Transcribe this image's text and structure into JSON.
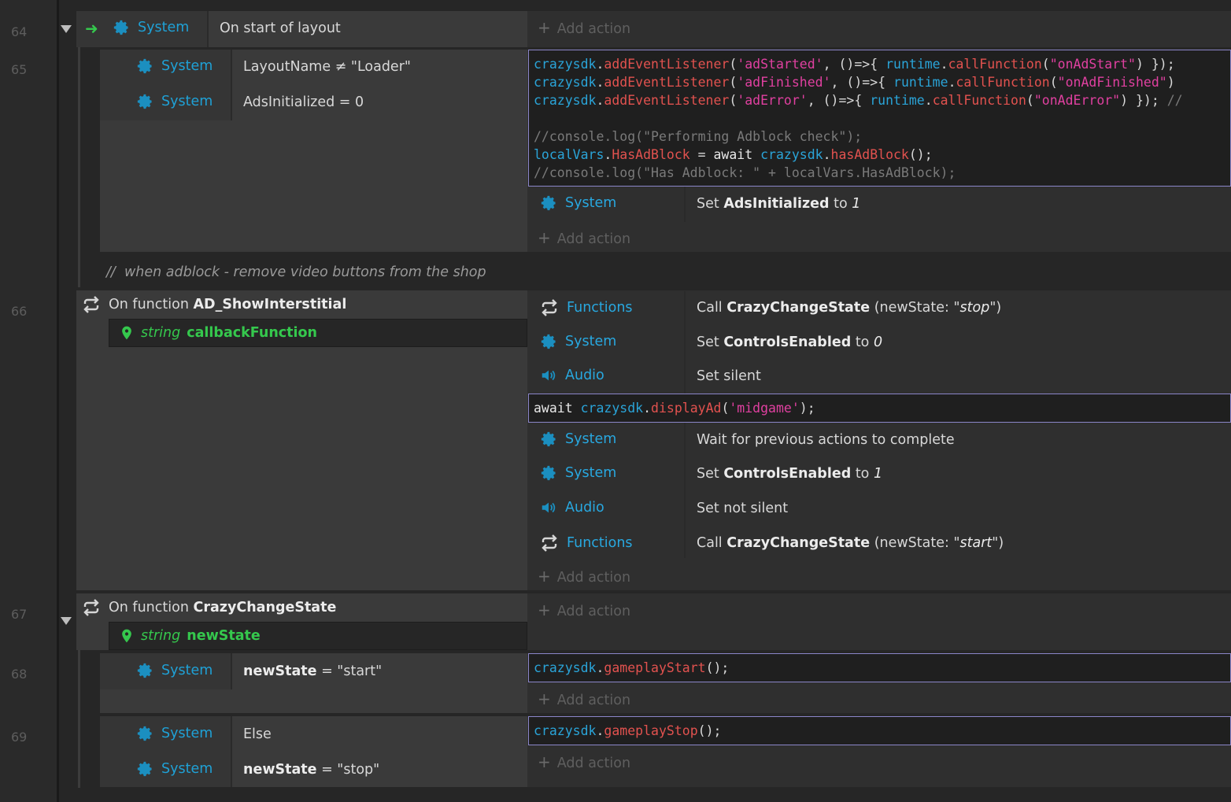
{
  "line_numbers": [
    "64",
    "65",
    "66",
    "67",
    "68",
    "69"
  ],
  "add_action": "Add action",
  "event64": {
    "object": "System",
    "condition": "On start of layout",
    "sub": {
      "conditions": [
        {
          "object": "System",
          "text": "LayoutName ≠ \"Loader\""
        },
        {
          "object": "System",
          "text": "AdsInitialized = 0"
        }
      ],
      "script_lines": [
        "crazysdk.addEventListener('adStarted', ()=>{ runtime.callFunction(\"onAdStart\") });",
        "crazysdk.addEventListener('adFinished', ()=>{ runtime.callFunction(\"onAdFinished\")",
        "crazysdk.addEventListener('adError', ()=>{ runtime.callFunction(\"onAdError\") }); //",
        "",
        "//console.log(\"Performing Adblock check\");",
        "localVars.HasAdBlock = await crazysdk.hasAdBlock();",
        "//console.log(\"Has Adblock: \" + localVars.HasAdBlock);"
      ],
      "action": {
        "object": "System",
        "pre": "Set",
        "bold": "AdsInitialized",
        "mid": "to",
        "val": "1"
      }
    }
  },
  "comment": "when adblock - remove video buttons from the shop",
  "comment_slashes": "//",
  "event66": {
    "on_function": "On function",
    "fn_name": "AD_ShowInterstitial",
    "param_type": "string",
    "param_name": "callbackFunction",
    "actions": [
      {
        "object": "Functions",
        "pre": "Call",
        "bold": "CrazyChangeState",
        "mid": "(newState: \"",
        "val": "stop",
        "post": "\")"
      },
      {
        "object": "System",
        "pre": "Set",
        "bold": "ControlsEnabled",
        "mid": "to",
        "val": "0"
      },
      {
        "object": "Audio",
        "pre": "Set silent"
      },
      {
        "object": "System",
        "pre": "Wait for previous actions to complete"
      },
      {
        "object": "System",
        "pre": "Set",
        "bold": "ControlsEnabled",
        "mid": "to",
        "val": "1"
      },
      {
        "object": "Audio",
        "pre": "Set not silent"
      },
      {
        "object": "Functions",
        "pre": "Call",
        "bold": "CrazyChangeState",
        "mid": "(newState: \"",
        "val": "start",
        "post": "\")"
      }
    ],
    "script": "await crazysdk.displayAd('midgame');"
  },
  "event67": {
    "on_function": "On function",
    "fn_name": "CrazyChangeState",
    "param_type": "string",
    "param_name": "newState"
  },
  "event68": {
    "object": "System",
    "cond_bold": "newState",
    "cond_rest": " = \"start\"",
    "script": "crazysdk.gameplayStart();"
  },
  "event69": {
    "conditions": [
      {
        "object": "System",
        "text": "Else"
      },
      {
        "object": "System",
        "cond_bold": "newState",
        "cond_rest": " = \"stop\""
      }
    ],
    "script": "crazysdk.gameplayStop();"
  },
  "colors": {
    "object": "#1fa1d6",
    "param": "#35c84d",
    "code_border": "#8b86c9"
  }
}
